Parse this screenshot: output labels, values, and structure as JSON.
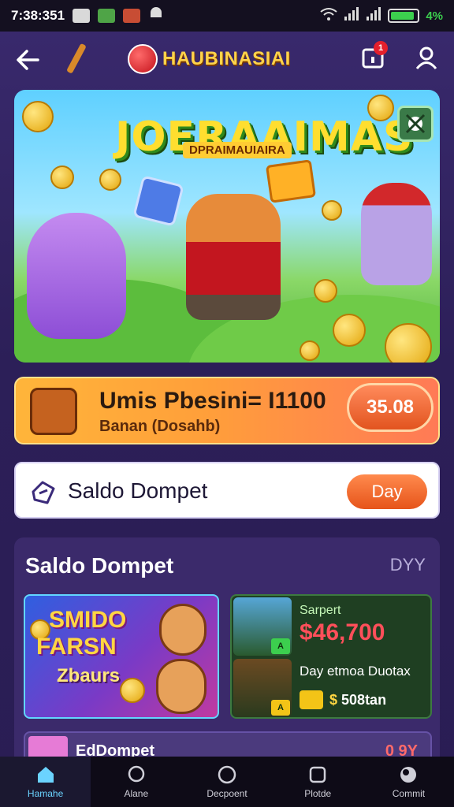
{
  "status_bar": {
    "time": "7:38:351",
    "battery_text": "4%",
    "battery_level": 0.9
  },
  "app_bar": {
    "brand": "HAUBINASIAI",
    "notification_count": "1"
  },
  "hero": {
    "title": "JOERAAIMAS",
    "subtitle": "DPRAIMAUIAIRA"
  },
  "promo": {
    "title": "Umis Pbesini= I1100",
    "subtitle": "Banan (Dosahb)",
    "button": "35.08"
  },
  "saldo_card": {
    "label": "Saldo Dompet",
    "button": "Day"
  },
  "section": {
    "title": "Saldo Dompet",
    "link": "DYY",
    "tile": {
      "line1": "SMIDO",
      "line2": "FARSN",
      "line3": "Zbaurs"
    },
    "info": {
      "label": "Sarpert",
      "amount": "$46,700",
      "desc": "Day etmoa Duotax",
      "tag_currency": "$",
      "tag_value": "508tan"
    },
    "peek": {
      "text": "EdDompet",
      "value": "0 9Y"
    }
  },
  "bottom_nav": [
    {
      "label": "Hamahe",
      "icon": "home-icon",
      "active": true
    },
    {
      "label": "Alane",
      "icon": "chat-icon",
      "active": false
    },
    {
      "label": "Decpoent",
      "icon": "circle-icon",
      "active": false
    },
    {
      "label": "Plotde",
      "icon": "square-icon",
      "active": false
    },
    {
      "label": "Commit",
      "icon": "globe-icon",
      "active": false
    }
  ]
}
